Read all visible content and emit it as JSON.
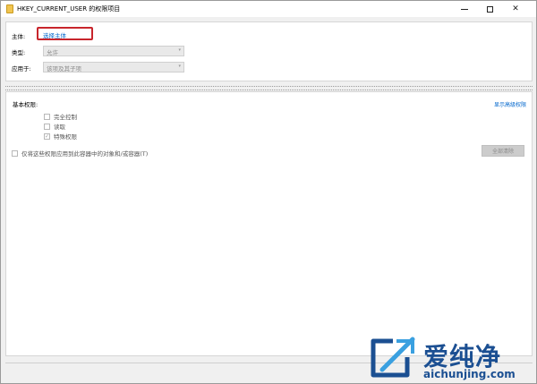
{
  "window": {
    "title": "HKEY_CURRENT_USER 的权限项目"
  },
  "titlebar": {
    "minimize_icon": "minimize-icon",
    "maximize_icon": "maximize-icon",
    "close_icon": "close-icon",
    "close_glyph": "✕"
  },
  "principal": {
    "label": "主体:",
    "link_text": "选择主体",
    "highlight_color": "#c8252c"
  },
  "type": {
    "label": "类型:",
    "value": "允许"
  },
  "applies_to": {
    "label": "应用于:",
    "value": "该项及其子项"
  },
  "combo_arrow": "▾",
  "permissions": {
    "title": "基本权限:",
    "advanced_link": "显示高级权限",
    "items": [
      {
        "label": "完全控制",
        "mark": ""
      },
      {
        "label": "读取",
        "mark": ""
      },
      {
        "label": "特殊权限",
        "mark": "✓"
      }
    ],
    "apply_only_label": "仅将这些权限应用到此容器中的对象和/或容器(T)",
    "clear_all_button": "全部清除"
  },
  "watermark": {
    "chinese": "爱纯净",
    "url": "aichunjing.com",
    "color": "#1b4f92"
  }
}
